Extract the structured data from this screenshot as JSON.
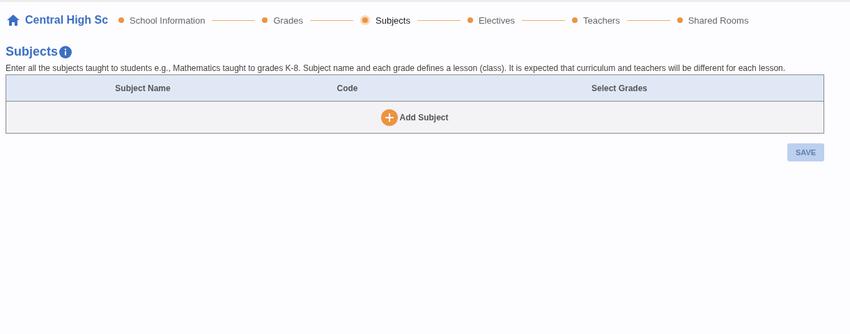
{
  "header": {
    "school": "Central High Sc"
  },
  "steps": [
    {
      "label": "School Information",
      "selected": false
    },
    {
      "label": "Grades",
      "selected": false
    },
    {
      "label": "Subjects",
      "selected": true
    },
    {
      "label": "Electives",
      "selected": false
    },
    {
      "label": "Teachers",
      "selected": false
    },
    {
      "label": "Shared Rooms",
      "selected": false
    }
  ],
  "section": {
    "title": "Subjects",
    "description": "Enter all the subjects taught to students e.g., Mathematics taught to grades K-8. Subject name and each grade defines a lesson (class). It is expected that curriculum and teachers will be different for each lesson."
  },
  "table": {
    "columns": [
      "Subject Name",
      "Code",
      "Select Grades"
    ],
    "add_label": "Add Subject"
  },
  "save": {
    "label": "SAVE",
    "disabled": true
  }
}
